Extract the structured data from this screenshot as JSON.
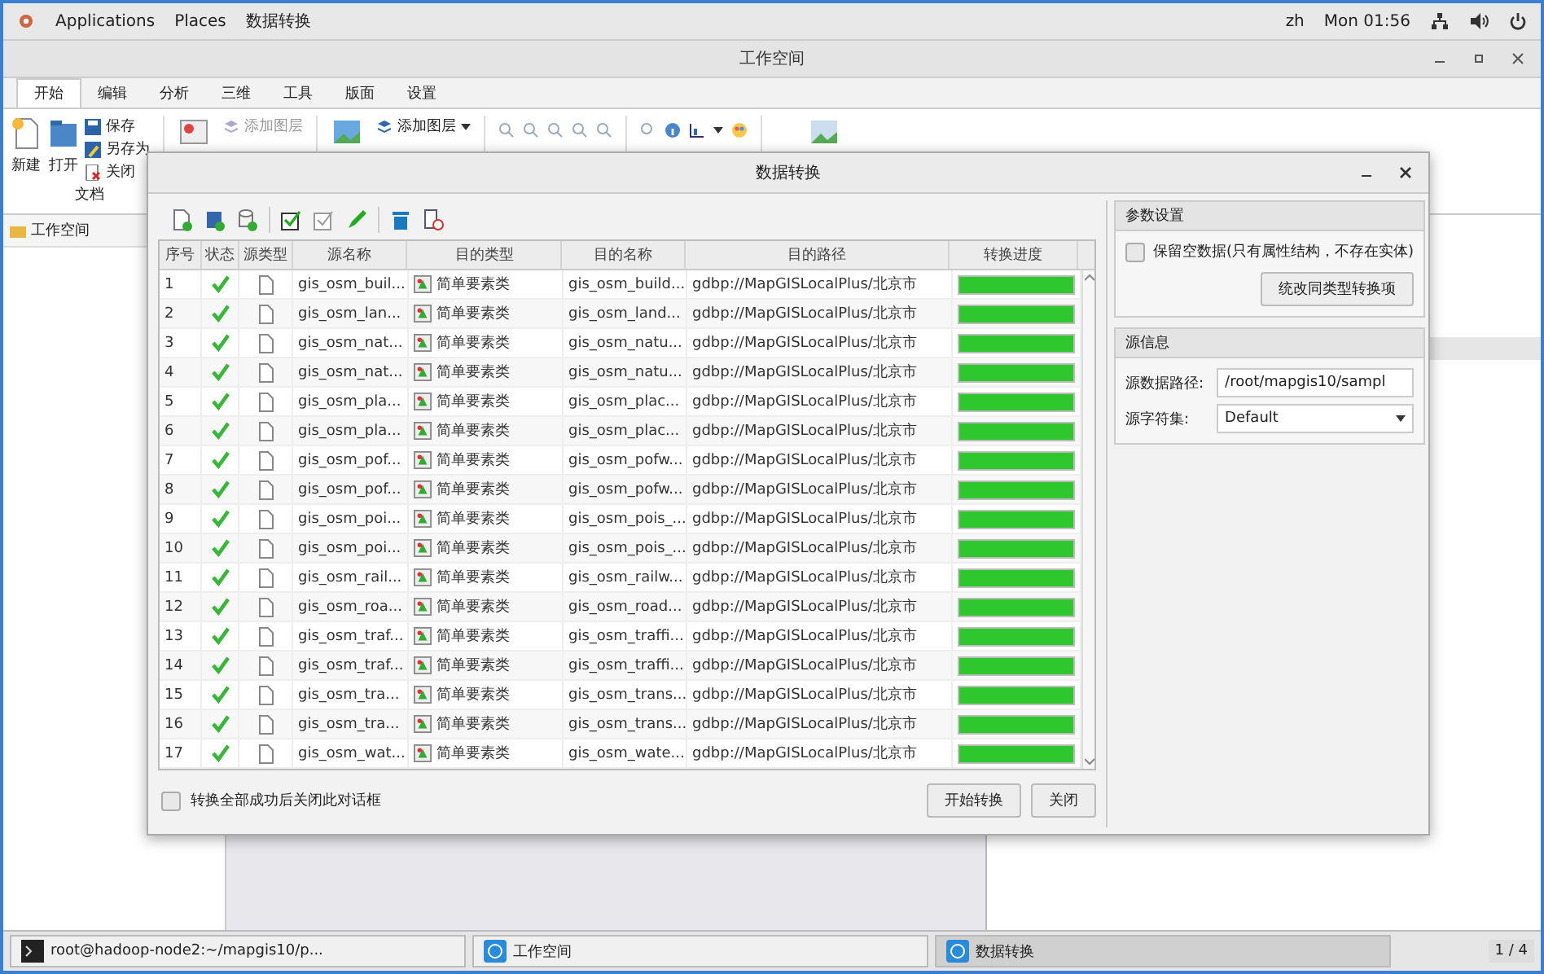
{
  "top_bar": {
    "applications": "Applications",
    "places": "Places",
    "app_name": "数据转换",
    "lang": "zh",
    "time": "Mon 01:56"
  },
  "workspace": {
    "title": "工作空间",
    "tabs": [
      {
        "label": "开始",
        "selected": true
      },
      {
        "label": "编辑",
        "selected": false
      },
      {
        "label": "分析",
        "selected": false
      },
      {
        "label": "三维",
        "selected": false
      },
      {
        "label": "工具",
        "selected": false
      },
      {
        "label": "版面",
        "selected": false
      },
      {
        "label": "设置",
        "selected": false
      }
    ],
    "ribbon": {
      "new": "新建",
      "open": "打开",
      "save": "保存",
      "save_as": "另存为",
      "close": "关闭",
      "group": "文档",
      "add_layer_disabled": "添加图层",
      "add_layer": "添加图层"
    },
    "left_panel_title": "工作空间"
  },
  "dialog": {
    "title": "数据转换",
    "columns": [
      "序号",
      "状态",
      "源类型",
      "源名称",
      "目的类型",
      "目的名称",
      "目的路径",
      "转换进度"
    ],
    "rows": [
      {
        "index": "1",
        "done": true,
        "source_name": "gis_osm_buil...",
        "dest_type": "简单要素类",
        "dest_name": "gis_osm_build...",
        "path": "gdbp://MapGISLocalPlus/北京市",
        "level": 1
      },
      {
        "index": "2",
        "done": true,
        "source_name": "gis_osm_lan...",
        "dest_type": "简单要素类",
        "dest_name": "gis_osm_land...",
        "path": "gdbp://MapGISLocalPlus/北京市",
        "level": 1
      },
      {
        "index": "3",
        "done": true,
        "source_name": "gis_osm_nat...",
        "dest_type": "简单要素类",
        "dest_name": "gis_osm_natu...",
        "path": "gdbp://MapGISLocalPlus/北京市",
        "level": 1
      },
      {
        "index": "4",
        "done": true,
        "source_name": "gis_osm_nat...",
        "dest_type": "简单要素类",
        "dest_name": "gis_osm_natu...",
        "path": "gdbp://MapGISLocalPlus/北京市",
        "level": 1
      },
      {
        "index": "5",
        "done": true,
        "source_name": "gis_osm_pla...",
        "dest_type": "简单要素类",
        "dest_name": "gis_osm_plac...",
        "path": "gdbp://MapGISLocalPlus/北京市",
        "level": 1
      },
      {
        "index": "6",
        "done": true,
        "source_name": "gis_osm_pla...",
        "dest_type": "简单要素类",
        "dest_name": "gis_osm_plac...",
        "path": "gdbp://MapGISLocalPlus/北京市",
        "level": 1
      },
      {
        "index": "7",
        "done": true,
        "source_name": "gis_osm_pof...",
        "dest_type": "简单要素类",
        "dest_name": "gis_osm_pofw...",
        "path": "gdbp://MapGISLocalPlus/北京市",
        "level": 1
      },
      {
        "index": "8",
        "done": true,
        "source_name": "gis_osm_pof...",
        "dest_type": "简单要素类",
        "dest_name": "gis_osm_pofw...",
        "path": "gdbp://MapGISLocalPlus/北京市",
        "level": 1
      },
      {
        "index": "9",
        "done": true,
        "source_name": "gis_osm_poi...",
        "dest_type": "简单要素类",
        "dest_name": "gis_osm_pois_...",
        "path": "gdbp://MapGISLocalPlus/北京市",
        "level": 1
      },
      {
        "index": "10",
        "done": true,
        "source_name": "gis_osm_poi...",
        "dest_type": "简单要素类",
        "dest_name": "gis_osm_pois_...",
        "path": "gdbp://MapGISLocalPlus/北京市",
        "level": 1
      },
      {
        "index": "11",
        "done": true,
        "source_name": "gis_osm_rail...",
        "dest_type": "简单要素类",
        "dest_name": "gis_osm_railw...",
        "path": "gdbp://MapGISLocalPlus/北京市",
        "level": 1
      },
      {
        "index": "12",
        "done": true,
        "source_name": "gis_osm_roa...",
        "dest_type": "简单要素类",
        "dest_name": "gis_osm_road...",
        "path": "gdbp://MapGISLocalPlus/北京市",
        "level": 1
      },
      {
        "index": "13",
        "done": true,
        "source_name": "gis_osm_traf...",
        "dest_type": "简单要素类",
        "dest_name": "gis_osm_traffi...",
        "path": "gdbp://MapGISLocalPlus/北京市",
        "level": 1
      },
      {
        "index": "14",
        "done": true,
        "source_name": "gis_osm_traf...",
        "dest_type": "简单要素类",
        "dest_name": "gis_osm_traffi...",
        "path": "gdbp://MapGISLocalPlus/北京市",
        "level": 1
      },
      {
        "index": "15",
        "done": true,
        "source_name": "gis_osm_tra...",
        "dest_type": "简单要素类",
        "dest_name": "gis_osm_trans...",
        "path": "gdbp://MapGISLocalPlus/北京市",
        "level": 1
      },
      {
        "index": "16",
        "done": true,
        "source_name": "gis_osm_tra...",
        "dest_type": "简单要素类",
        "dest_name": "gis_osm_trans...",
        "path": "gdbp://MapGISLocalPlus/北京市",
        "level": 1
      },
      {
        "index": "17",
        "done": true,
        "source_name": "gis_osm_wat...",
        "dest_type": "简单要素类",
        "dest_name": "gis_osm_wate...",
        "path": "gdbp://MapGISLocalPlus/北京市",
        "level": 1
      }
    ],
    "params": {
      "title": "参数设置",
      "keep_empty": {
        "label": "保留空数据(只有属性结构，不存在实体)",
        "checked": false
      },
      "button": "统改同类型转换项"
    },
    "source": {
      "title": "源信息",
      "path_label": "源数据路径:",
      "path_value": "/root/mapgis10/sampl",
      "charset_label": "源字符集:",
      "charset_value": "Default"
    },
    "close_when_done": {
      "label": "转换全部成功后关闭此对话框",
      "checked": false
    },
    "buttons": [
      "开始转换",
      "关闭"
    ]
  },
  "taskbar": {
    "items": [
      {
        "kind": "terminal",
        "label": "root@hadoop-node2:~/mapgis10/p...",
        "selected": false
      },
      {
        "kind": "app",
        "label": "工作空间",
        "selected": false
      },
      {
        "kind": "app",
        "label": "数据转换",
        "selected": true
      }
    ],
    "pager": "1 / 4"
  }
}
